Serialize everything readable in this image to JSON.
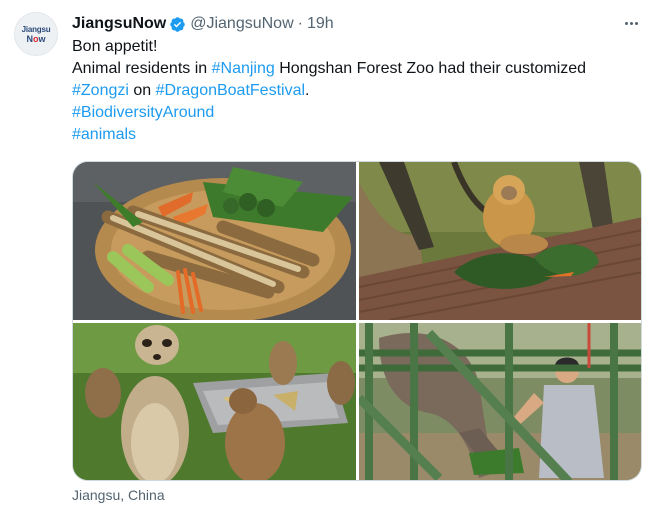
{
  "account": {
    "avatar_line1": "Jiangsu",
    "avatar_line2a": "N",
    "avatar_line2b": "o",
    "avatar_line2c": "w",
    "name": "JiangsuNow",
    "handle": "@JiangsuNow",
    "separator": "·",
    "time": "19h"
  },
  "tweet": {
    "line1": "Bon appetit!",
    "line2_before": "Animal residents in ",
    "line2_tag": "#Nanjing",
    "line2_after": " Hongshan Forest Zoo had their customized",
    "line3_tag1": "#Zongzi",
    "line3_mid": " on ",
    "line3_tag2": "#DragonBoatFestival",
    "line3_end": ".",
    "line4_tag": "#BiodiversityAround",
    "line5_tag": "#animals"
  },
  "location": "Jiangsu, China",
  "colors": {
    "link": "#1d9bf0",
    "verified": "#1d9bf0",
    "secondary_text": "#536471"
  }
}
